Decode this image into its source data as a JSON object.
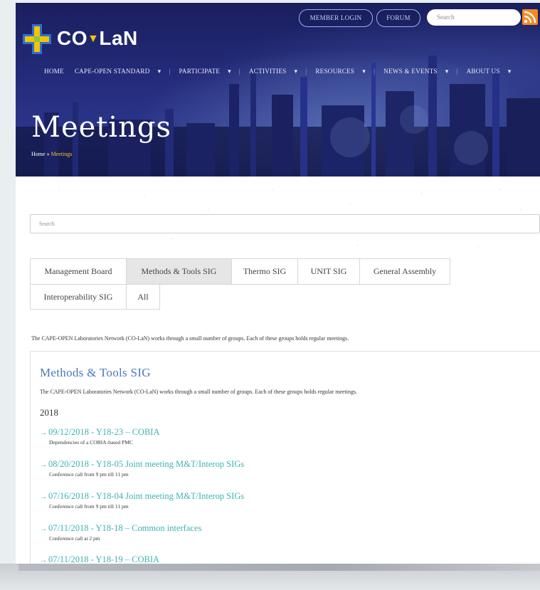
{
  "header": {
    "logo_text": "CO",
    "logo_text2": "LaN",
    "member_login": "MEMBER LOGIN",
    "forum": "FORUM",
    "search_placeholder": "Search"
  },
  "nav": {
    "items": [
      "HOME",
      "CAPE-OPEN STANDARD",
      "PARTICIPATE",
      "ACTIVITIES",
      "RESOURCES",
      "NEWS & EVENTS",
      "ABOUT US"
    ]
  },
  "page": {
    "title": "Meetings",
    "breadcrumb_home": "Home",
    "breadcrumb_current": "Meetings"
  },
  "search": {
    "placeholder": "Search"
  },
  "tabs": [
    {
      "label": "Management Board",
      "active": false
    },
    {
      "label": "Methods & Tools SIG",
      "active": true
    },
    {
      "label": "Thermo SIG",
      "active": false
    },
    {
      "label": "UNIT SIG",
      "active": false
    },
    {
      "label": "General Assembly",
      "active": false
    },
    {
      "label": "Interoperability SIG",
      "active": false
    },
    {
      "label": "All",
      "active": false
    }
  ],
  "intro": "The CAPE-OPEN Laboratories Network (CO-LaN) works through a small number of groups. Each of these groups holds regular meetings.",
  "panel": {
    "title": "Methods & Tools SIG",
    "description": "The CAPE-OPEN Laboratories Network (CO-LaN) works through a small number of groups. Each of these groups holds regular meetings.",
    "year": "2018",
    "meetings": [
      {
        "title": "09/12/2018 - Y18-23 – COBIA",
        "sub": "Dependencies of a COBIA-based PMC"
      },
      {
        "title": "08/20/2018 - Y18-05 Joint meeting M&T/Interop SIGs",
        "sub": "Conference call from 9 pm till 11 pm"
      },
      {
        "title": "07/16/2018 - Y18-04 Joint meeting M&T/Interop SIGs",
        "sub": "Conference call from 9 pm till 11 pm"
      },
      {
        "title": "07/11/2018 - Y18-18 – Common interfaces",
        "sub": "Conference call at 2 pm"
      },
      {
        "title": "07/11/2018 - Y18-19 – COBIA",
        "sub": ""
      }
    ]
  },
  "colors": {
    "accent": "#3fb3b0",
    "title_blue": "#4a7bb8",
    "header_bg": "#232a78",
    "logo_yellow": "#f5c400"
  }
}
